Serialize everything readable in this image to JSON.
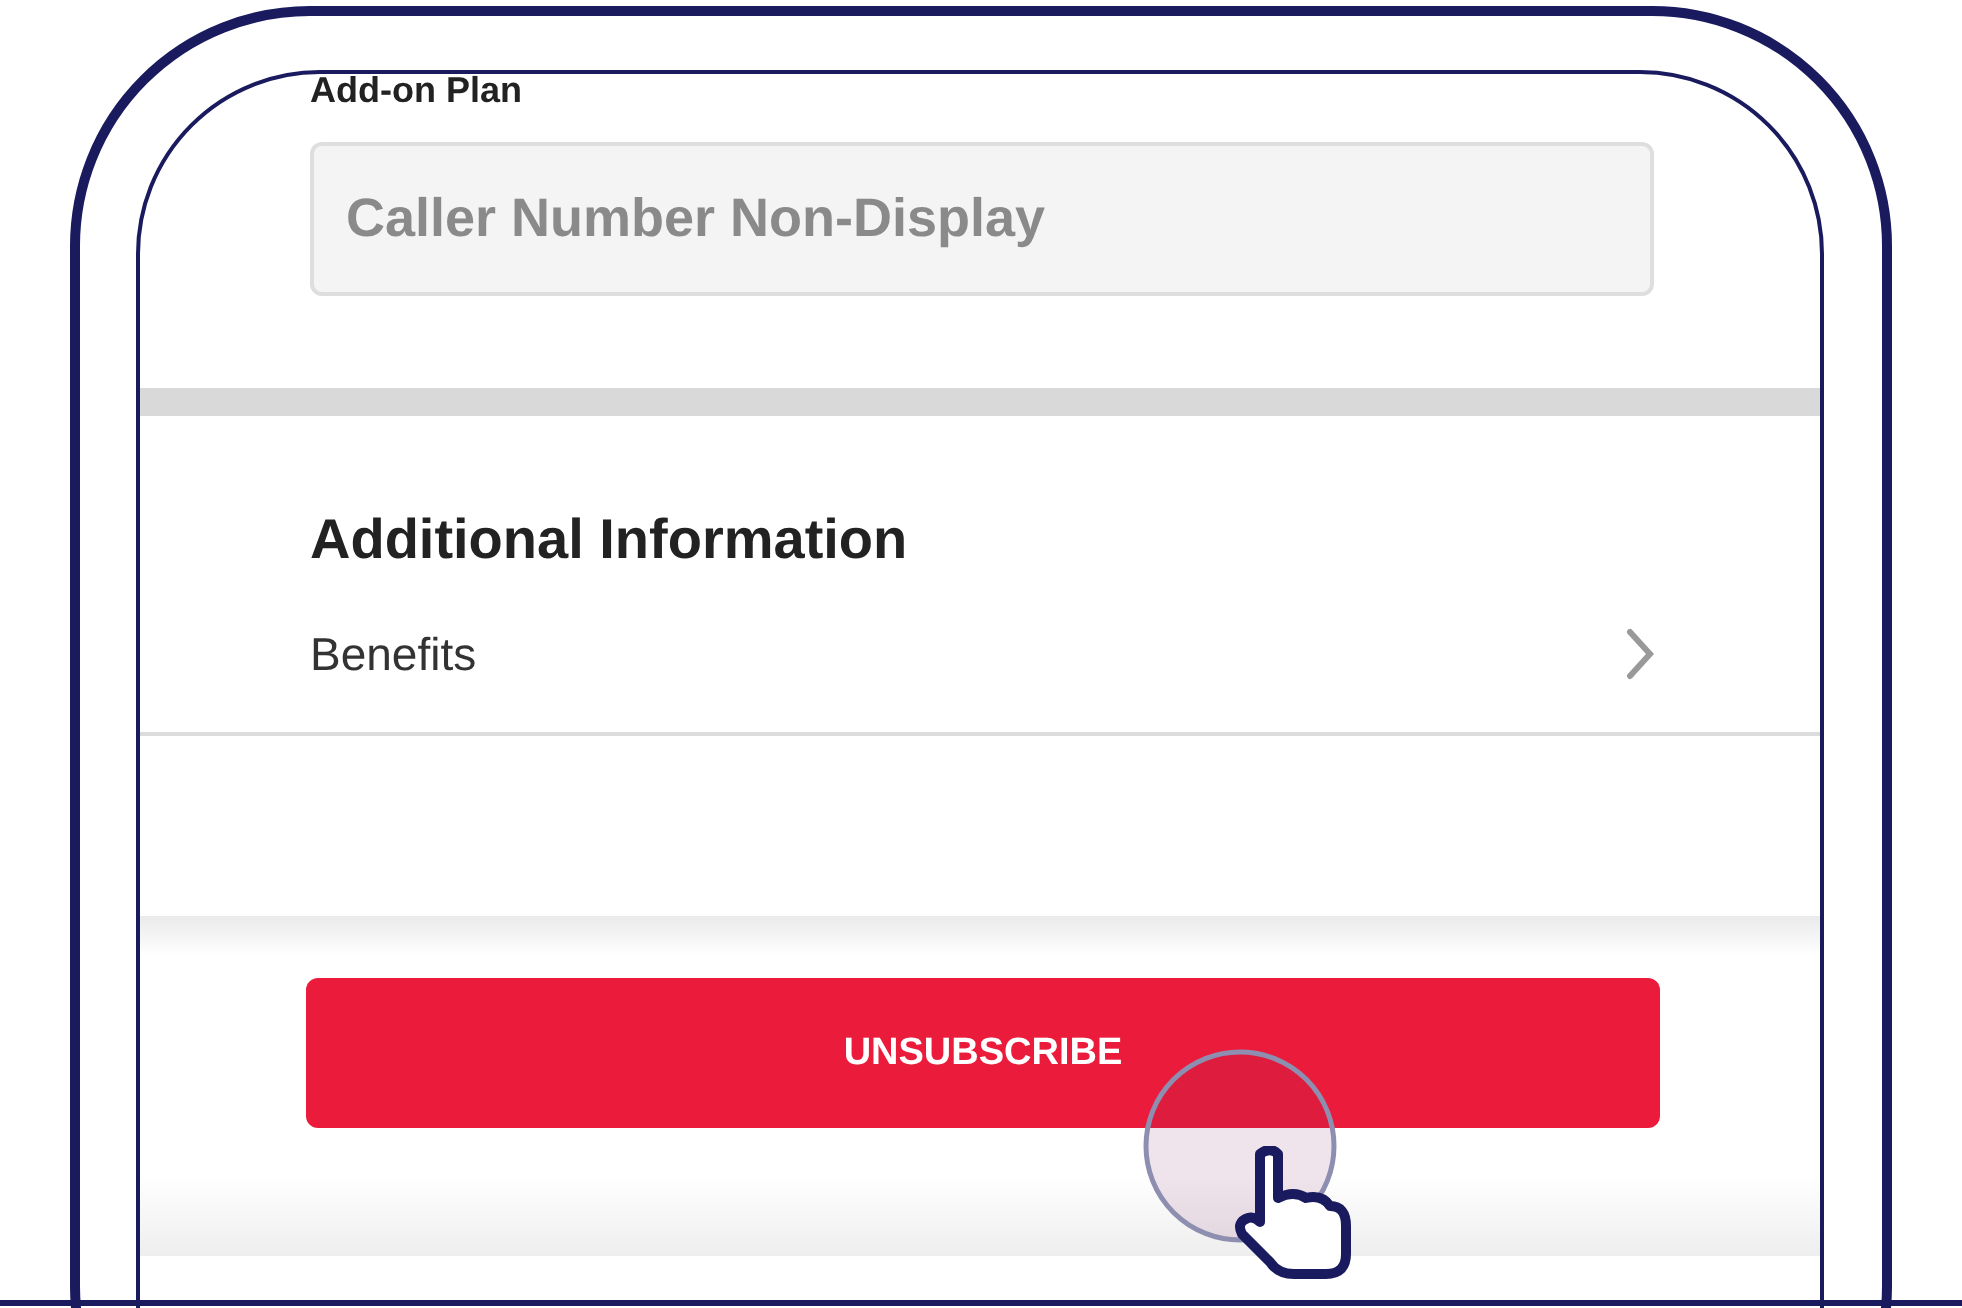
{
  "addon_plan": {
    "label": "Add-on Plan",
    "field": {
      "value": "Caller Number Non-Display",
      "disabled": true
    }
  },
  "additional_information": {
    "title": "Additional Information",
    "items": [
      {
        "label": "Benefits"
      }
    ]
  },
  "primary_button": {
    "label": "UNSUBSCRIBE",
    "pressed": true
  }
}
